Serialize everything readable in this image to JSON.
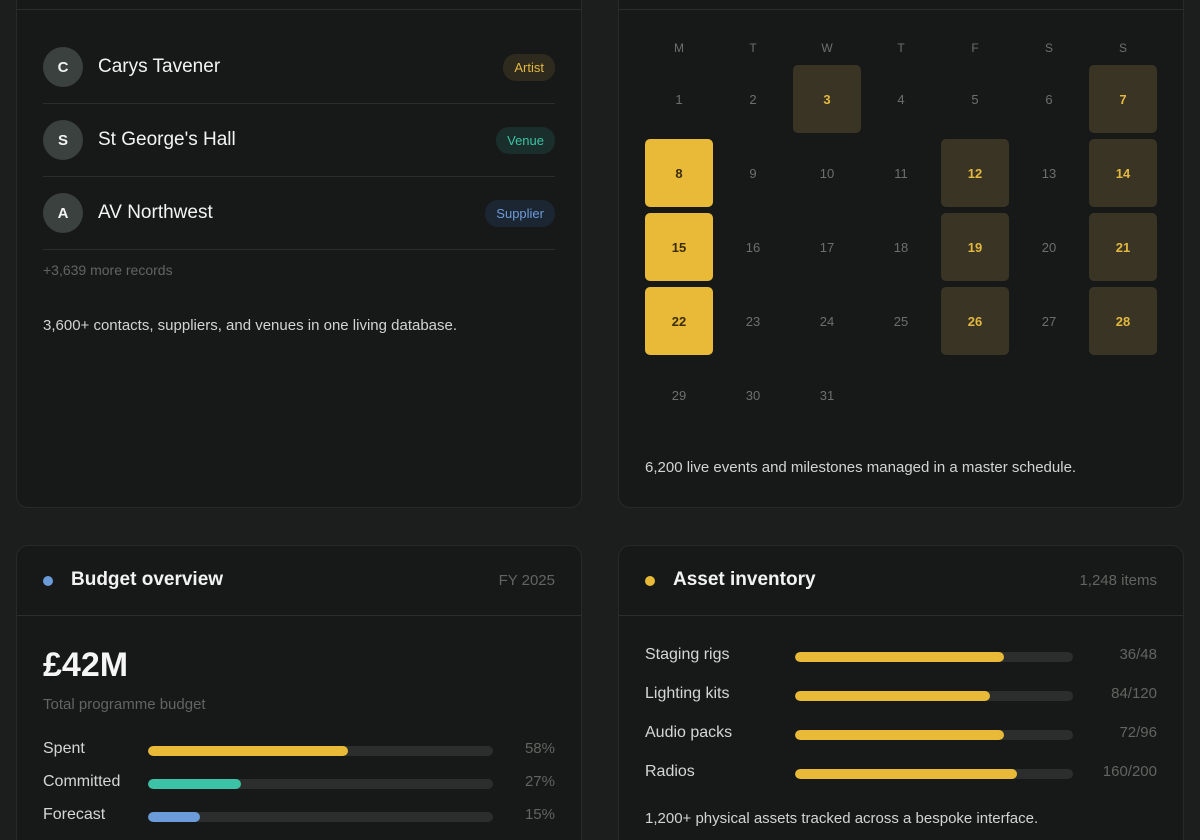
{
  "contacts": {
    "records": [
      {
        "initial": "C",
        "name": "Carys Tavener",
        "tag": "Artist",
        "tag_color": "#e2b840",
        "tag_bg": "#2e2a1e"
      },
      {
        "initial": "S",
        "name": "St George's Hall",
        "tag": "Venue",
        "tag_color": "#3cc2a6",
        "tag_bg": "#1a2e2b"
      },
      {
        "initial": "A",
        "name": "AV Northwest",
        "tag": "Supplier",
        "tag_color": "#6b9bd8",
        "tag_bg": "#1c2633"
      }
    ],
    "more_records": "+3,639 more records",
    "footer": "3,600+ contacts, suppliers, and venues in one living database."
  },
  "calendar": {
    "weekdays": [
      "M",
      "T",
      "W",
      "T",
      "F",
      "S",
      "S"
    ],
    "days": [
      {
        "label": "1",
        "state": "none"
      },
      {
        "label": "2",
        "state": "none"
      },
      {
        "label": "3",
        "state": "muted"
      },
      {
        "label": "4",
        "state": "none"
      },
      {
        "label": "5",
        "state": "none"
      },
      {
        "label": "6",
        "state": "none"
      },
      {
        "label": "7",
        "state": "muted"
      },
      {
        "label": "8",
        "state": "strong"
      },
      {
        "label": "9",
        "state": "none"
      },
      {
        "label": "10",
        "state": "none"
      },
      {
        "label": "11",
        "state": "none"
      },
      {
        "label": "12",
        "state": "muted"
      },
      {
        "label": "13",
        "state": "none"
      },
      {
        "label": "14",
        "state": "muted"
      },
      {
        "label": "15",
        "state": "strong"
      },
      {
        "label": "16",
        "state": "none"
      },
      {
        "label": "17",
        "state": "none"
      },
      {
        "label": "18",
        "state": "none"
      },
      {
        "label": "19",
        "state": "muted"
      },
      {
        "label": "20",
        "state": "none"
      },
      {
        "label": "21",
        "state": "muted"
      },
      {
        "label": "22",
        "state": "strong"
      },
      {
        "label": "23",
        "state": "none"
      },
      {
        "label": "24",
        "state": "none"
      },
      {
        "label": "25",
        "state": "none"
      },
      {
        "label": "26",
        "state": "muted"
      },
      {
        "label": "27",
        "state": "none"
      },
      {
        "label": "28",
        "state": "muted"
      },
      {
        "label": "29",
        "state": "none"
      },
      {
        "label": "30",
        "state": "none"
      },
      {
        "label": "31",
        "state": "none"
      }
    ],
    "footer": "6,200 live events and milestones managed in a master schedule."
  },
  "budget": {
    "title": "Budget overview",
    "meta": "FY 2025",
    "dot_color": "#6b9bd8",
    "total": "£42M",
    "total_label": "Total programme budget",
    "bars": [
      {
        "label": "Spent",
        "value": "58%",
        "fraction": 0.58,
        "color": "#e8ba38"
      },
      {
        "label": "Committed",
        "value": "27%",
        "fraction": 0.27,
        "color": "#3cc2a6"
      },
      {
        "label": "Forecast",
        "value": "15%",
        "fraction": 0.15,
        "color": "#6b9bd8"
      }
    ]
  },
  "assets": {
    "title": "Asset inventory",
    "meta": "1,248 items",
    "dot_color": "#e8ba38",
    "bars": [
      {
        "label": "Staging rigs",
        "value": "36/48",
        "fraction": 0.75,
        "color": "#e8ba38"
      },
      {
        "label": "Lighting kits",
        "value": "84/120",
        "fraction": 0.7,
        "color": "#e8ba38"
      },
      {
        "label": "Audio packs",
        "value": "72/96",
        "fraction": 0.75,
        "color": "#e8ba38"
      },
      {
        "label": "Radios",
        "value": "160/200",
        "fraction": 0.8,
        "color": "#e8ba38"
      }
    ],
    "footer": "1,200+ physical assets tracked across a bespoke interface."
  }
}
